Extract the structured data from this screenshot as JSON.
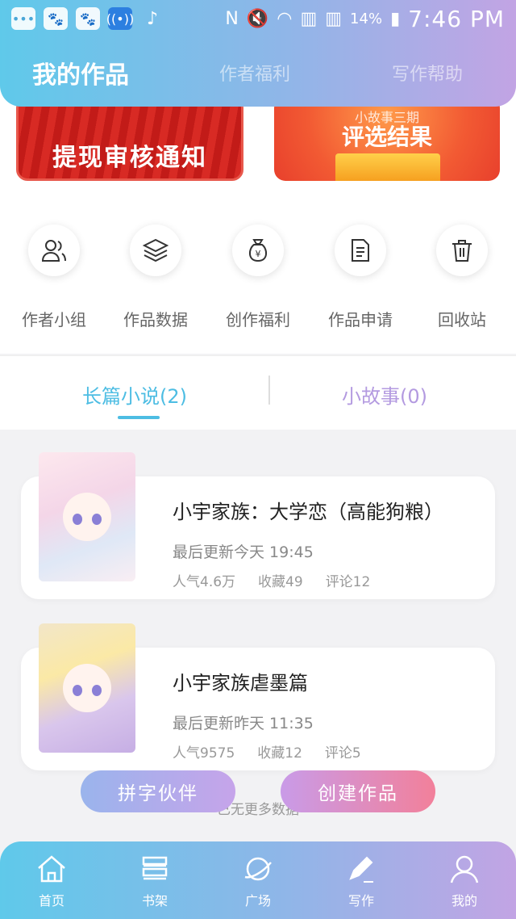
{
  "status_bar": {
    "battery": "14%",
    "time": "7:46 PM"
  },
  "header": {
    "tabs": [
      {
        "label": "我的作品",
        "active": true
      },
      {
        "label": "作者福利",
        "active": false
      },
      {
        "label": "写作帮助",
        "active": false
      }
    ]
  },
  "banners": [
    {
      "text": "提现审核通知"
    },
    {
      "subtext": "小故事三期",
      "text": "评选结果"
    }
  ],
  "quick_actions": [
    {
      "label": "作者小组",
      "icon": "group-icon"
    },
    {
      "label": "作品数据",
      "icon": "layers-icon"
    },
    {
      "label": "创作福利",
      "icon": "money-bag-icon"
    },
    {
      "label": "作品申请",
      "icon": "document-icon"
    },
    {
      "label": "回收站",
      "icon": "trash-icon"
    }
  ],
  "content_tabs": {
    "left": "长篇小说(2)",
    "right": "小故事(0)"
  },
  "works": [
    {
      "title": "小宇家族：大学恋（高能狗粮）",
      "updated": "最后更新今天 19:45",
      "popularity": "人气4.6万",
      "favorites": "收藏49",
      "comments": "评论12"
    },
    {
      "title": "小宇家族虐墨篇",
      "updated": "最后更新昨天 11:35",
      "popularity": "人气9575",
      "favorites": "收藏12",
      "comments": "评论5"
    }
  ],
  "no_more": "已无更多数据",
  "fabs": {
    "partner": "拼字伙伴",
    "create": "创建作品"
  },
  "bottom_nav": [
    {
      "label": "首页",
      "icon": "home-icon"
    },
    {
      "label": "书架",
      "icon": "bookshelf-icon"
    },
    {
      "label": "广场",
      "icon": "planet-icon"
    },
    {
      "label": "写作",
      "icon": "pen-icon",
      "active": true
    },
    {
      "label": "我的",
      "icon": "profile-icon"
    }
  ],
  "colors": {
    "accent_blue": "#4dbde3",
    "accent_purple": "#b39ae0",
    "gradient_start": "#5fc9ea",
    "gradient_end": "#c2a4e4"
  }
}
